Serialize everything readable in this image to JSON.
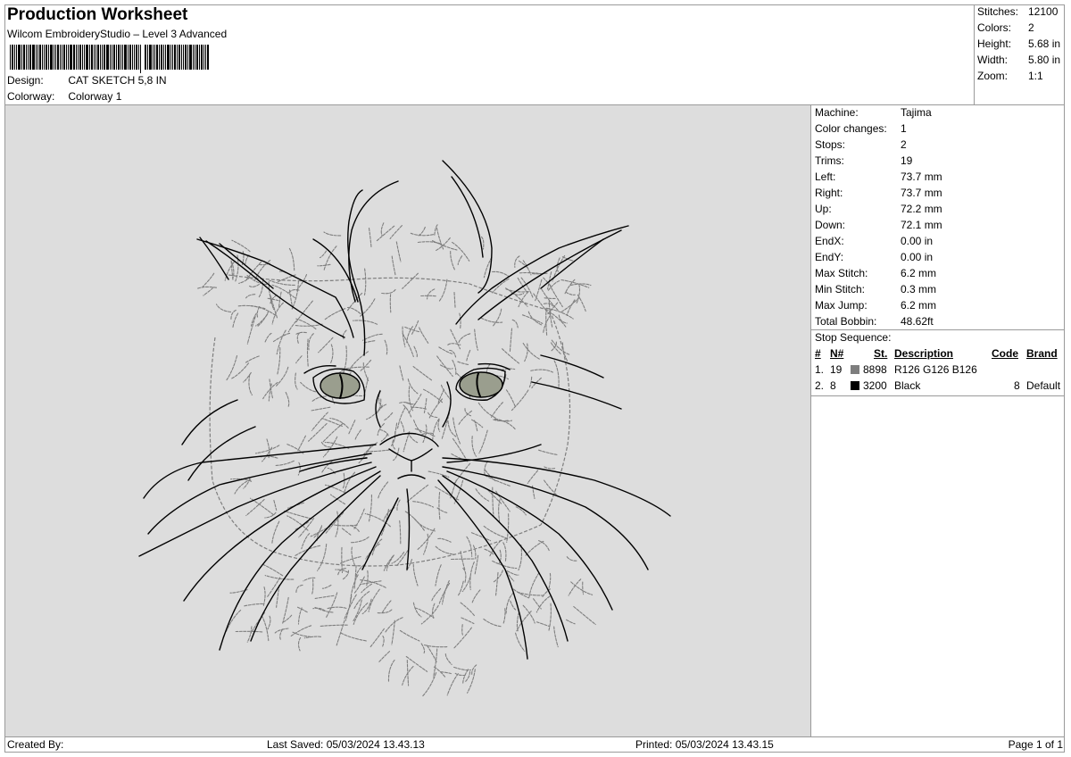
{
  "header": {
    "title": "Production Worksheet",
    "subtitle": "Wilcom EmbroideryStudio – Level 3 Advanced",
    "design_label": "Design:",
    "design_value": "CAT SKETCH 5,8 IN",
    "colorway_label": "Colorway:",
    "colorway_value": "Colorway 1"
  },
  "stats": {
    "stitches_label": "Stitches:",
    "stitches_value": "12100",
    "colors_label": "Colors:",
    "colors_value": "2",
    "height_label": "Height:",
    "height_value": "5.68 in",
    "width_label": "Width:",
    "width_value": "5.80 in",
    "zoom_label": "Zoom:",
    "zoom_value": "1:1"
  },
  "machine": [
    {
      "label": "Machine:",
      "value": "Tajima"
    },
    {
      "label": "Color changes:",
      "value": "1"
    },
    {
      "label": "Stops:",
      "value": "2"
    },
    {
      "label": "Trims:",
      "value": "19"
    },
    {
      "label": "Left:",
      "value": "73.7 mm"
    },
    {
      "label": "Right:",
      "value": "73.7 mm"
    },
    {
      "label": "Up:",
      "value": "72.2 mm"
    },
    {
      "label": "Down:",
      "value": "72.1 mm"
    },
    {
      "label": "EndX:",
      "value": "0.00 in"
    },
    {
      "label": "EndY:",
      "value": "0.00 in"
    },
    {
      "label": "Max Stitch:",
      "value": "6.2 mm"
    },
    {
      "label": "Min Stitch:",
      "value": "0.3 mm"
    },
    {
      "label": "Max Jump:",
      "value": "6.2 mm"
    },
    {
      "label": "Total Bobbin:",
      "value": "48.62ft"
    }
  ],
  "stop_sequence": {
    "title": "Stop Sequence:",
    "headers": {
      "num": "#",
      "n": "N#",
      "st": "St.",
      "description": "Description",
      "code": "Code",
      "brand": "Brand"
    },
    "rows": [
      {
        "num": "1.",
        "n": "19",
        "color": "#7e7e7e",
        "st": "8898",
        "description": "R126 G126 B126",
        "code": "",
        "brand": ""
      },
      {
        "num": "2.",
        "n": "8",
        "color": "#000000",
        "st": "3200",
        "description": "Black",
        "code": "8",
        "brand": "Default"
      }
    ]
  },
  "footer": {
    "created_by": "Created By:",
    "last_saved": "Last Saved: 05/03/2024 13.43.13",
    "printed": "Printed: 05/03/2024 13.43.15",
    "page": "Page 1 of 1"
  },
  "colors": {
    "canvas_bg": "#dddddd",
    "stitch_gray": "#7e7e7e",
    "stitch_black": "#000000",
    "border": "#9a9a9a"
  },
  "design_image": {
    "description": "cat-face-embroidery-sketch"
  }
}
